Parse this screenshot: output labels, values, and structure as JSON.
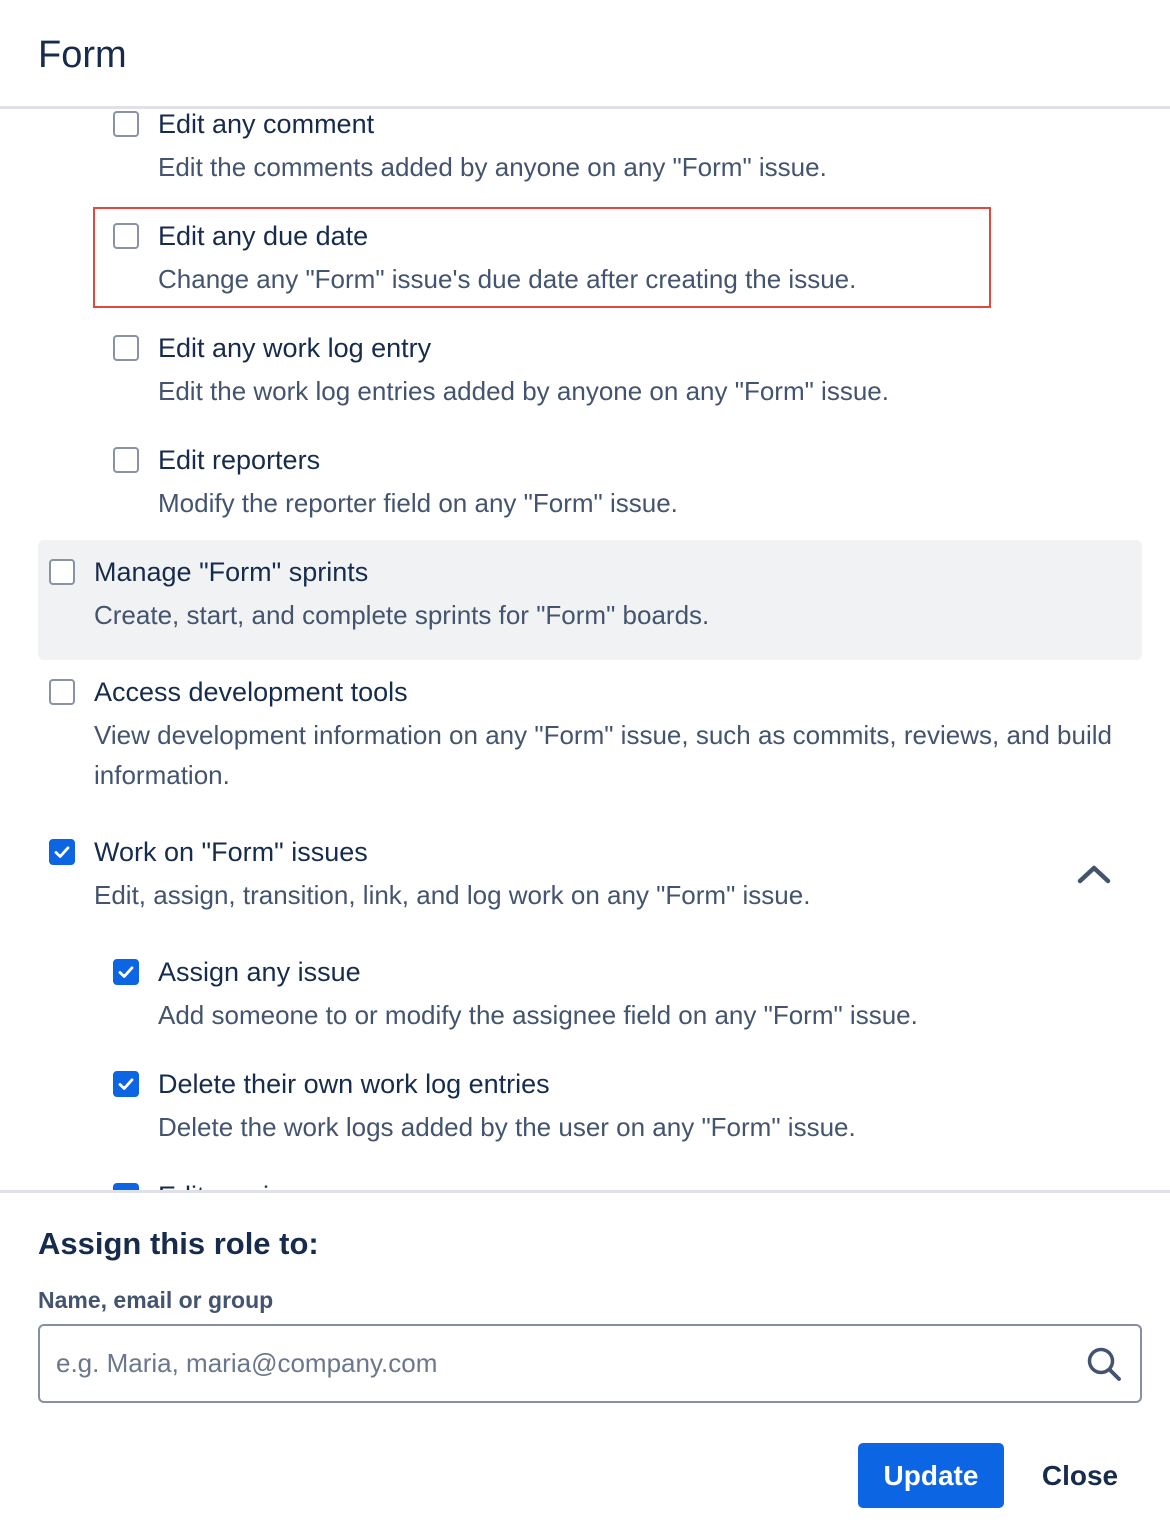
{
  "dialog": {
    "title": "Form"
  },
  "permissions": [
    {
      "title": "Edit any comment",
      "desc": "Edit the comments added by anyone on any \"Form\" issue.",
      "checked": false
    },
    {
      "title": "Edit any due date",
      "desc": "Change any \"Form\" issue's due date after creating the issue.",
      "checked": false,
      "highlighted": true
    },
    {
      "title": "Edit any work log entry",
      "desc": "Edit the work log entries added by anyone on any \"Form\" issue.",
      "checked": false
    },
    {
      "title": "Edit reporters",
      "desc": "Modify the reporter field on any \"Form\" issue.",
      "checked": false
    },
    {
      "title": "Manage \"Form\" sprints",
      "desc": "Create, start, and complete sprints for \"Form\" boards.",
      "checked": false,
      "hovered": true
    },
    {
      "title": "Access development tools",
      "desc": "View development information on any \"Form\" issue, such as commits, reviews, and build information.",
      "checked": false
    },
    {
      "title": "Work on \"Form\" issues",
      "desc": "Edit, assign, transition, link, and log work on any \"Form\" issue.",
      "checked": true,
      "expanded": true
    },
    {
      "title": "Assign any issue",
      "desc": "Add someone to or modify the assignee field on any \"Form\" issue.",
      "checked": true
    },
    {
      "title": "Delete their own work log entries",
      "desc": "Delete the work logs added by the user on any \"Form\" issue.",
      "checked": true
    },
    {
      "title": "Edit any issue",
      "desc": "",
      "checked": true,
      "partially_visible": true
    }
  ],
  "assign": {
    "title": "Assign this role to:",
    "field_label": "Name, email or group",
    "placeholder": "e.g. Maria, maria@company.com",
    "value": ""
  },
  "footer": {
    "update_label": "Update",
    "close_label": "Close"
  },
  "colors": {
    "primary": "#0c66e4",
    "highlight": "#e2483d",
    "hover_bg": "#f1f2f4",
    "text": "#172b4d",
    "subtext": "#44546f"
  }
}
